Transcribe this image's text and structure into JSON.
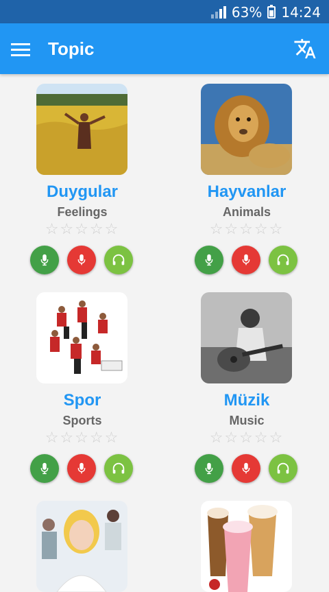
{
  "status": {
    "battery_text": "63%",
    "time": "14:24"
  },
  "app_bar": {
    "title": "Topic",
    "menu_icon": "hamburger-menu-icon",
    "translate_icon": "translate-icon"
  },
  "colors": {
    "primary": "#2196f3",
    "status_bar": "#1f63a9",
    "btn_green_dark": "#43a047",
    "btn_red": "#e53935",
    "btn_green_light": "#7cc242",
    "star_empty": "#cfcfcf"
  },
  "topics": [
    {
      "title": "Duygular",
      "subtitle": "Feelings",
      "rating": 0,
      "image": "woman-in-field-photo"
    },
    {
      "title": "Hayvanlar",
      "subtitle": "Animals",
      "rating": 0,
      "image": "lion-photo"
    },
    {
      "title": "Spor",
      "subtitle": "Sports",
      "rating": 0,
      "image": "athletes-collage-photo"
    },
    {
      "title": "Müzik",
      "subtitle": "Music",
      "rating": 0,
      "image": "guitar-player-photo"
    },
    {
      "title": "",
      "subtitle": "",
      "rating": 0,
      "image": "business-people-photo"
    },
    {
      "title": "",
      "subtitle": "",
      "rating": 0,
      "image": "milkshakes-photo"
    }
  ],
  "stars_text": "☆☆☆☆☆"
}
